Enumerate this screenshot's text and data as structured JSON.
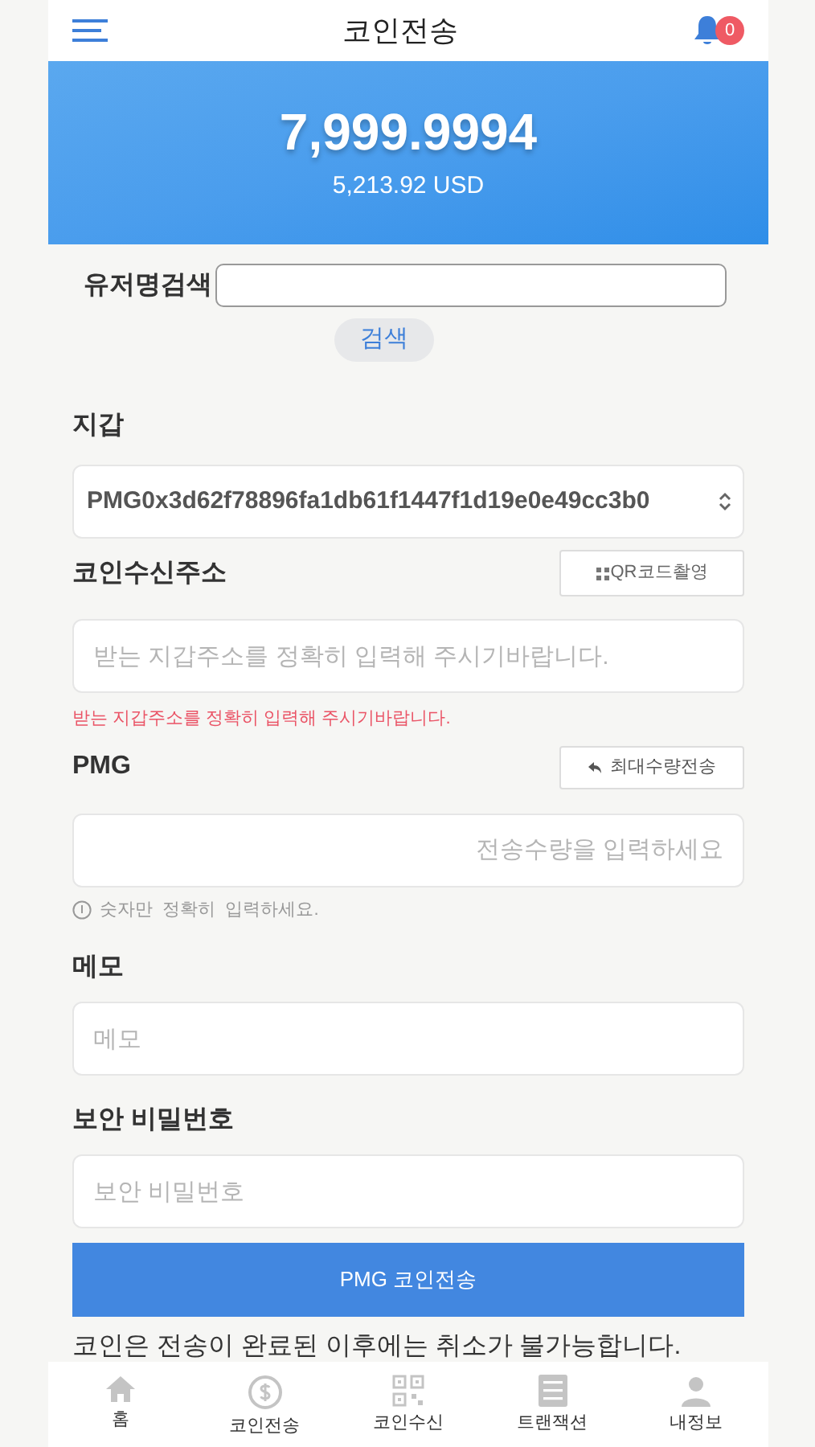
{
  "header": {
    "title": "코인전송",
    "notification_count": "0"
  },
  "balance": {
    "amount": "7,999.9994",
    "usd": "5,213.92 USD"
  },
  "user_search": {
    "label": "유저명검색",
    "button": "검색"
  },
  "wallet": {
    "label": "지갑",
    "value": "PMG0x3d62f78896fa1db61f1447f1d19e0e49cc3b0"
  },
  "address": {
    "label": "코인수신주소",
    "qr_button": "QR코드촬영",
    "placeholder": "받는 지갑주소를 정확히 입력해 주시기바랍니다.",
    "error": "받는 지갑주소를 정확히 입력해 주시기바랍니다."
  },
  "amount": {
    "label": "PMG",
    "max_button": "최대수량전송",
    "placeholder": "전송수량을 입력하세요",
    "hint": "숫자만  정확히  입력하세요."
  },
  "memo": {
    "label": "메모",
    "placeholder": "메모"
  },
  "password": {
    "label": "보안 비밀번호",
    "placeholder": "보안 비밀번호"
  },
  "submit": "PMG 코인전송",
  "notice": "코인은 전송이 완료된 이후에는 취소가 불가능합니다.",
  "nav": [
    {
      "kind": "home",
      "label": "홈"
    },
    {
      "kind": "send",
      "label": "코인전송"
    },
    {
      "kind": "receive",
      "label": "코인수신"
    },
    {
      "kind": "transactions",
      "label": "트랜잭션"
    },
    {
      "kind": "profile",
      "label": "내정보"
    }
  ]
}
